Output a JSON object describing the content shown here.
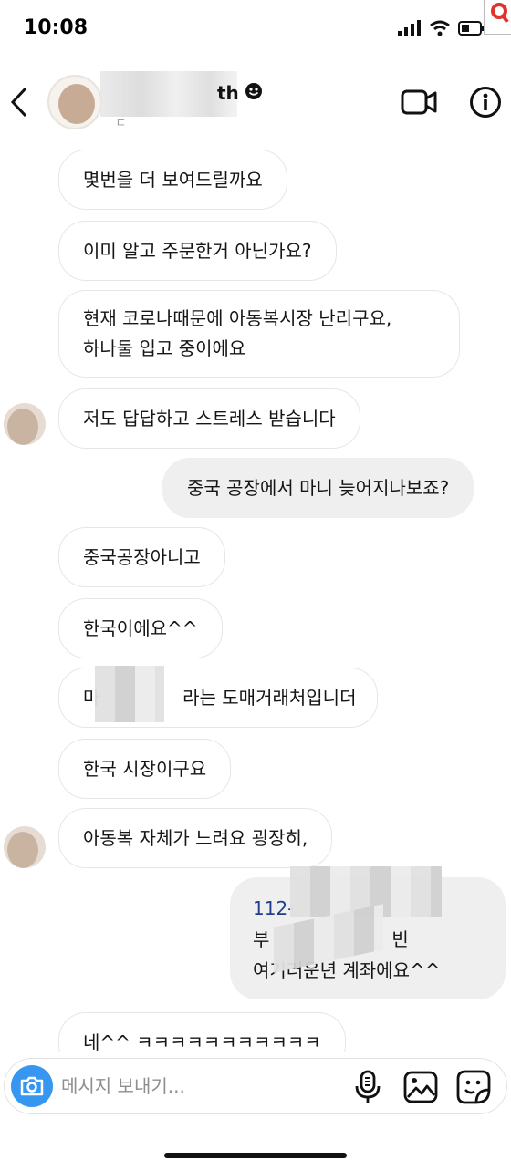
{
  "status_bar": {
    "time": "10:08"
  },
  "header": {
    "name_suffix": "th",
    "sub_name": "_ㄷ"
  },
  "messages": [
    {
      "side": "in",
      "text": "몇번을 더 보여드릴까요"
    },
    {
      "side": "in",
      "text": "이미 알고 주문한거 아닌가요?"
    },
    {
      "side": "in",
      "lines": [
        "현재 코로나때문에 아동복시장 난리구요,",
        "하나둘 입고 중이에요"
      ]
    },
    {
      "side": "in",
      "text": "저도 답답하고 스트레스 받습니다"
    },
    {
      "side": "out",
      "text": "중국 공장에서 마니 늦어지나보죠?"
    },
    {
      "side": "in",
      "text": "중국공장아니고"
    },
    {
      "side": "in",
      "text": "한국이에요^^"
    },
    {
      "side": "in",
      "text_start": "마",
      "text_end": "라는 도매거래처입니더"
    },
    {
      "side": "in",
      "text": "한국 시장이구요"
    },
    {
      "side": "in",
      "text": "아동복 자체가 느려요 굉장히,"
    },
    {
      "side": "out",
      "line1": "112-",
      "line2_start": "부",
      "line2_end": "빈",
      "line3_start": "여기",
      "line3_end": "러운년 계좌에요^^"
    },
    {
      "side": "in",
      "text": "네^^ ㅋㅋㅋㅋㅋㅋㅋㅋㅋㅋㅋ"
    }
  ],
  "composer": {
    "placeholder": "메시지 보내기..."
  },
  "icons": {
    "back": "chevron-left-icon",
    "video": "video-camera-icon",
    "info": "info-icon",
    "camera": "camera-icon",
    "mic": "microphone-icon",
    "gallery": "image-icon",
    "sticker": "sticker-icon"
  },
  "colors": {
    "camera_button": "#3797f0",
    "outgoing_bubble": "#efefef",
    "link_text": "#1f3f8a"
  }
}
